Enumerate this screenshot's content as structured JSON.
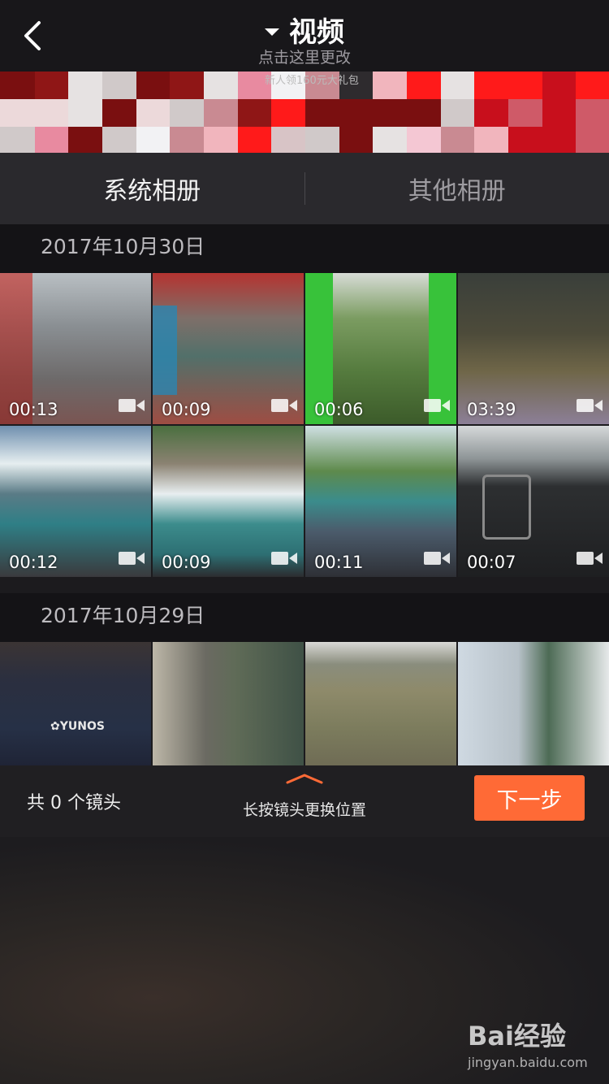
{
  "header": {
    "title": "视频",
    "subtitle": "点击这里更改"
  },
  "banner": {
    "text": "新人领160元大礼包"
  },
  "album_tabs": [
    {
      "label": "系统相册",
      "active": true
    },
    {
      "label": "其他相册",
      "active": false
    }
  ],
  "sections": [
    {
      "date": "2017年10月30日",
      "videos": [
        {
          "duration": "00:13",
          "scene": "bridge-walkway"
        },
        {
          "duration": "00:09",
          "scene": "red-railing-walkway"
        },
        {
          "duration": "00:06",
          "scene": "cable-car-view"
        },
        {
          "duration": "03:39",
          "scene": "indoor-exhibit"
        },
        {
          "duration": "00:12",
          "scene": "waterfall-show"
        },
        {
          "duration": "00:09",
          "scene": "ship-waterfall"
        },
        {
          "duration": "00:11",
          "scene": "crowd-lake"
        },
        {
          "duration": "00:07",
          "scene": "car-dashboard"
        }
      ]
    },
    {
      "date": "2017年10月29日",
      "videos": [
        {
          "duration": "",
          "scene": "yunos-screen"
        },
        {
          "duration": "",
          "scene": "stepping-stones"
        },
        {
          "duration": "",
          "scene": "river-bank"
        },
        {
          "duration": "",
          "scene": "washing-machine"
        }
      ]
    }
  ],
  "bottom_bar": {
    "shot_count": "共 0 个镜头",
    "hint": "长按镜头更换位置",
    "next_label": "下一步"
  },
  "watermark": {
    "logo": "Bai经验",
    "url": "jingyan.baidu.com"
  },
  "colors": {
    "accent": "#ff6a36",
    "background": "#1c1b1e",
    "tab_bar": "#2a292d"
  }
}
